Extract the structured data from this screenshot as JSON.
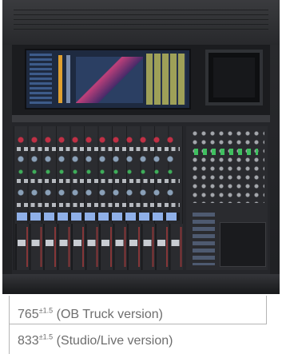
{
  "dimensions": [
    {
      "value": "765",
      "tolerance": "±1.5",
      "label": "(OB Truck version)"
    },
    {
      "value": "833",
      "tolerance": "±1.5",
      "label": "(Studio/Live version)"
    }
  ]
}
